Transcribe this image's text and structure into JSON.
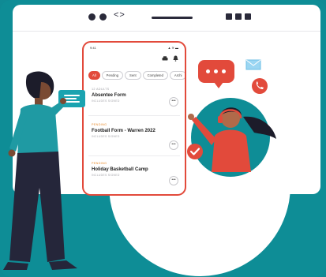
{
  "browser": {
    "nav_glyph": "<>"
  },
  "phone": {
    "status_time": "9:41",
    "status_icons": "▲ ≋ ▬",
    "tabs": [
      {
        "label": "All",
        "active": true
      },
      {
        "label": "Pending",
        "active": false
      },
      {
        "label": "Sent",
        "active": false
      },
      {
        "label": "Completed",
        "active": false
      },
      {
        "label": "Archi",
        "active": false
      }
    ],
    "cards": [
      {
        "tag": "12 ADULTS",
        "title": "Absentee Form",
        "sub": "INCLUDES SIGNED",
        "tag_color": "grey"
      },
      {
        "tag": "PENDING",
        "title": "Football Form - Warren 2022",
        "sub": "INCLUDES SIGNED",
        "tag_color": "orange"
      },
      {
        "tag": "PENDING",
        "title": "Holiday Basketball Camp",
        "sub": "INCLUDES SIGNED",
        "tag_color": "orange"
      }
    ],
    "more_glyph": "•••"
  },
  "icons": {
    "envelope": "envelope-icon",
    "phone": "phone-icon",
    "check": "check-icon",
    "printer": "printer-icon",
    "bell": "bell-icon"
  },
  "colors": {
    "teal": "#0e8d96",
    "red": "#e24a3b",
    "orange": "#e98b2b",
    "light_blue": "#8fd3f0",
    "navy": "#25263a"
  }
}
